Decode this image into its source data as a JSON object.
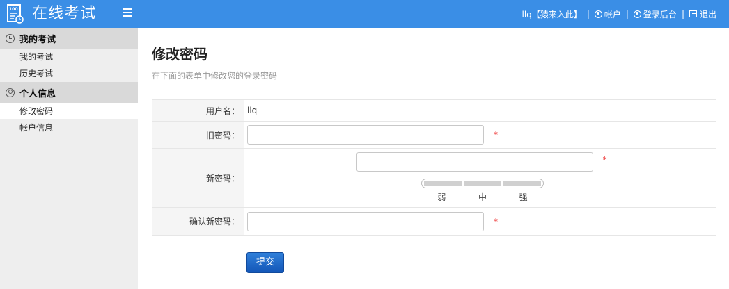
{
  "header": {
    "title": "在线考试",
    "logo_icon": "exam-paper-icon",
    "menu_icon": "hamburger-icon",
    "user_text": "llq【猿来入此】",
    "nav": [
      {
        "label": "帐户",
        "icon": "user-circle-icon"
      },
      {
        "label": "登录后台",
        "icon": "user-circle-icon"
      },
      {
        "label": "退出",
        "icon": "exit-icon"
      }
    ],
    "separator": "|",
    "background": "#3a8ee6"
  },
  "sidebar": {
    "groups": [
      {
        "label": "我的考试",
        "icon": "clock-icon",
        "items": [
          "我的考试",
          "历史考试"
        ]
      },
      {
        "label": "个人信息",
        "icon": "person-icon",
        "items": [
          "修改密码",
          "帐户信息"
        ]
      }
    ],
    "active_item": "修改密码"
  },
  "main": {
    "title": "修改密码",
    "subtitle": "在下面的表单中修改您的登录密码",
    "form": {
      "username_label": "用户名：",
      "username_value": "llq",
      "old_password_label": "旧密码：",
      "new_password_label": "新密码：",
      "confirm_password_label": "确认新密码：",
      "required_mark": "*",
      "strength_labels": [
        "弱",
        "中",
        "强"
      ],
      "submit_label": "提交"
    }
  },
  "colors": {
    "accent": "#3a8ee6",
    "button": "#1a62c6",
    "required": "#ee3333"
  }
}
